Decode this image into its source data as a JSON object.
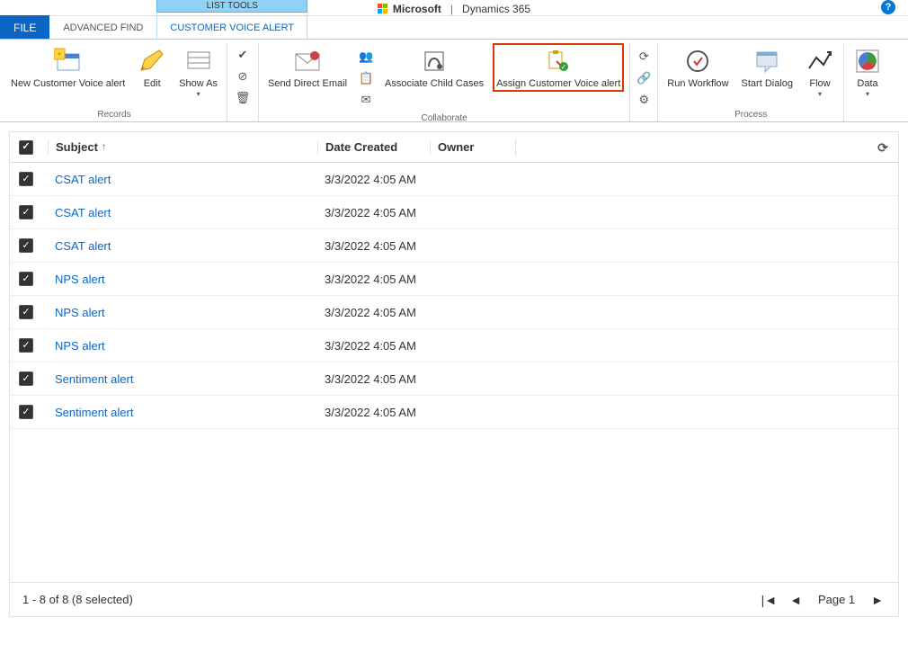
{
  "header": {
    "brand1": "Microsoft",
    "brand2": "Dynamics 365"
  },
  "tabs": {
    "file": "FILE",
    "advanced_find": "ADVANCED FIND",
    "group_label": "LIST TOOLS",
    "customer_voice_alert": "CUSTOMER VOICE ALERT"
  },
  "ribbon": {
    "records": {
      "label": "Records",
      "new_alert": "New Customer Voice alert",
      "edit": "Edit",
      "show_as": "Show As"
    },
    "delete_group": {
      "delete": ""
    },
    "collaborate": {
      "label": "Collaborate",
      "send_email": "Send Direct Email",
      "associate": "Associate Child Cases",
      "assign": "Assign Customer Voice alert"
    },
    "process": {
      "label": "Process",
      "run_workflow": "Run Workflow",
      "start_dialog": "Start Dialog",
      "flow": "Flow"
    },
    "data": {
      "label": "Data"
    }
  },
  "grid": {
    "columns": {
      "subject": "Subject",
      "date": "Date Created",
      "owner": "Owner"
    },
    "rows": [
      {
        "subject": "CSAT alert",
        "date": "3/3/2022 4:05 AM"
      },
      {
        "subject": "CSAT alert",
        "date": "3/3/2022 4:05 AM"
      },
      {
        "subject": "CSAT alert",
        "date": "3/3/2022 4:05 AM"
      },
      {
        "subject": "NPS alert",
        "date": "3/3/2022 4:05 AM"
      },
      {
        "subject": "NPS alert",
        "date": "3/3/2022 4:05 AM"
      },
      {
        "subject": "NPS alert",
        "date": "3/3/2022 4:05 AM"
      },
      {
        "subject": "Sentiment alert",
        "date": "3/3/2022 4:05 AM"
      },
      {
        "subject": "Sentiment alert",
        "date": "3/3/2022 4:05 AM"
      }
    ],
    "footer_status": "1 - 8 of 8 (8 selected)",
    "page_label": "Page 1"
  }
}
